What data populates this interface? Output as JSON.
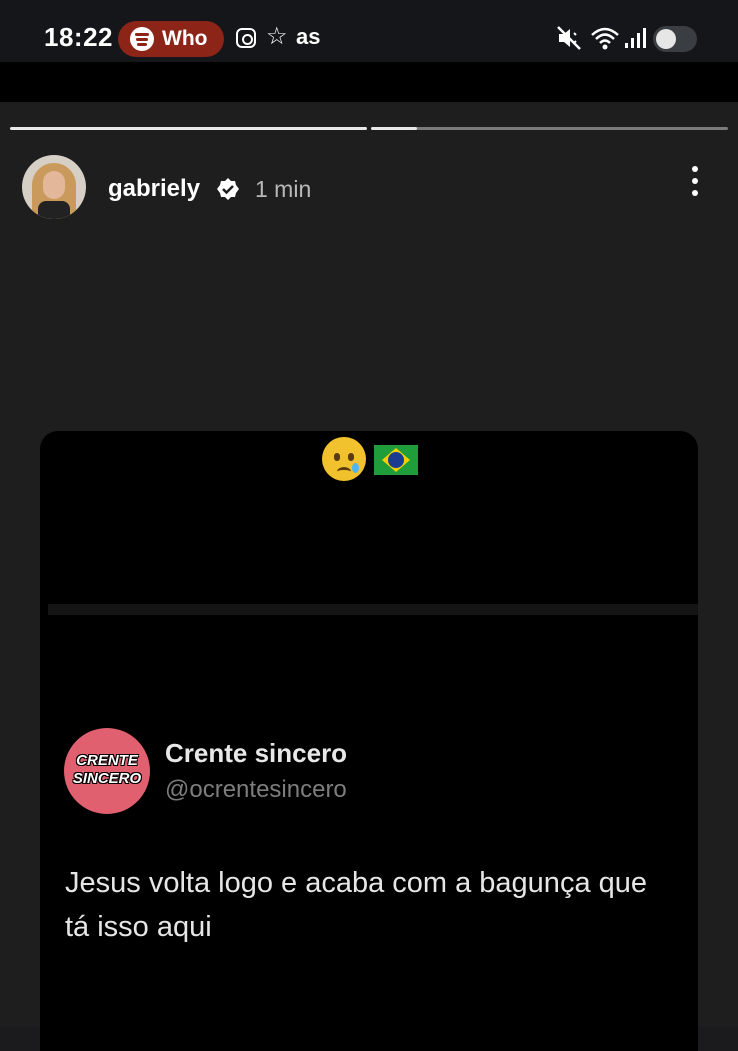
{
  "status_bar": {
    "time": "18:22",
    "spotify_label": "Who",
    "pill_color": "#8d2418",
    "left_icons": [
      "spotify-icon",
      "instagram-icon",
      "star-icon",
      "as-icon"
    ],
    "as_text": "as",
    "right_icons": [
      "mute-icon",
      "wifi-icon",
      "signal-icon",
      "toggle"
    ]
  },
  "story": {
    "progress_count": 2,
    "username": "gabriely",
    "verified": true,
    "time_ago": "1 min",
    "menu_icon": "more-vertical-icon"
  },
  "content": {
    "emojis": [
      "crying-face-emoji",
      "brazil-flag-emoji"
    ],
    "tweet": {
      "avatar_text": "CRENTE SINCERO",
      "avatar_color": "#e06070",
      "name": "Crente sincero",
      "handle": "@ocrentesincero",
      "text": "Jesus volta logo e acaba com a bagunça que tá isso aqui"
    }
  }
}
